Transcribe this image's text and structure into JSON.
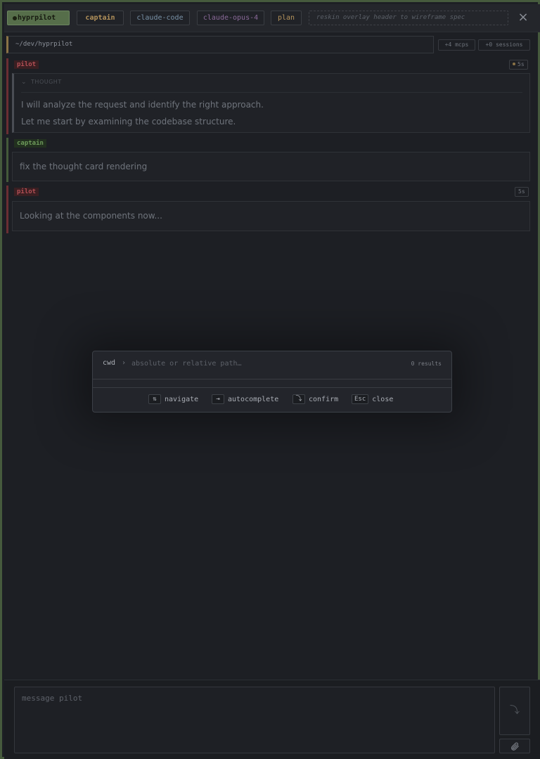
{
  "header": {
    "app_name": "hyprpilot",
    "profile": "captain",
    "agent": "claude-code",
    "model": "claude-opus-4",
    "mode": "plan",
    "task_title": "reskin overlay header to wireframe spec",
    "close_icon": "×"
  },
  "context": {
    "cwd": "~/dev/hyprpilot",
    "mcps": "+4 mcps",
    "sessions": "+0 sessions"
  },
  "conversation": [
    {
      "role": "pilot",
      "time": "5s",
      "thought": {
        "label": "THOUGHT",
        "lines": [
          "I will analyze the request and identify the right approach.",
          "Let me start by examining the codebase structure."
        ]
      }
    },
    {
      "role": "captain",
      "text": "fix the thought card rendering"
    },
    {
      "role": "pilot",
      "time": "5s",
      "text": "Looking at the components now..."
    }
  ],
  "palette": {
    "label": "cwd",
    "separator": "›",
    "placeholder": "absolute or relative path…",
    "results": "0 results",
    "hints": [
      {
        "key": "⇅",
        "label": "navigate"
      },
      {
        "key": "⇥",
        "label": "autocomplete"
      },
      {
        "key": "⤵",
        "label": "confirm"
      },
      {
        "key": "Esc",
        "label": "close"
      }
    ]
  },
  "composer": {
    "placeholder": "message pilot",
    "send_icon": "⤵"
  },
  "icons": {
    "status_dot": "dot-icon",
    "collapse": "chevron-down-icon",
    "close": "close-icon",
    "attach": "paperclip-icon",
    "send": "send-icon"
  },
  "colors": {
    "accent_green": "#566e4a",
    "pilot_red": "#b44f55",
    "captain_green": "#6d9a5a",
    "amber": "#b3925b"
  }
}
